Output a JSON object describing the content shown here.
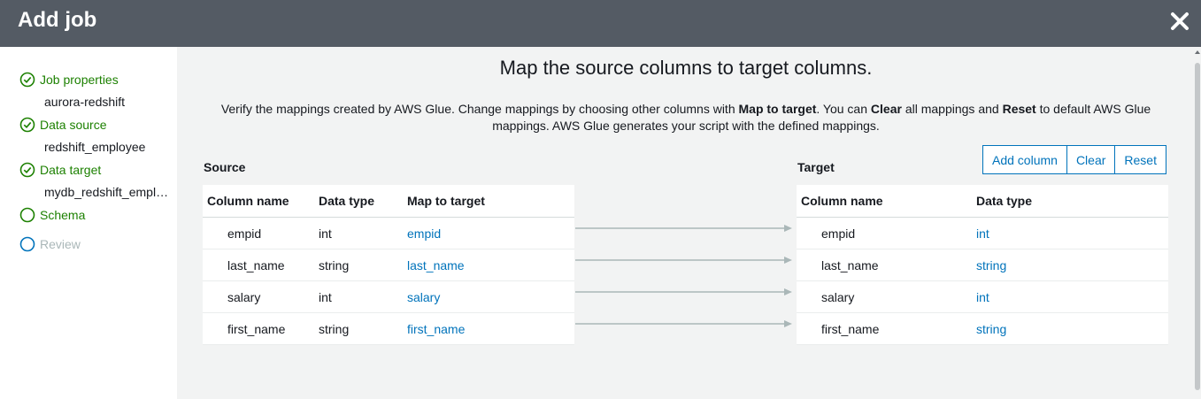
{
  "header": {
    "title": "Add job"
  },
  "steps": [
    {
      "label": "Job properties",
      "status": "complete",
      "value": "aurora-redshift"
    },
    {
      "label": "Data source",
      "status": "complete",
      "value": "redshift_employee"
    },
    {
      "label": "Data target",
      "status": "complete",
      "value": "mydb_redshift_employee"
    },
    {
      "label": "Schema",
      "status": "current"
    },
    {
      "label": "Review",
      "status": "disabled"
    }
  ],
  "main": {
    "heading": "Map the source columns to target columns.",
    "description": {
      "p1": "Verify the mappings created by AWS Glue. Change mappings by choosing other columns with ",
      "b1": "Map to target",
      "p2": ". You can ",
      "b2": "Clear",
      "p3": " all mappings and ",
      "b3": "Reset",
      "p4": " to default AWS Glue mappings. AWS Glue generates your script with the defined mappings."
    },
    "source_label": "Source",
    "target_label": "Target",
    "buttons": {
      "add_column": "Add column",
      "clear": "Clear",
      "reset": "Reset"
    }
  },
  "source_table": {
    "headers": [
      "Column name",
      "Data type",
      "Map to target"
    ],
    "rows": [
      [
        "empid",
        "int",
        "empid"
      ],
      [
        "last_name",
        "string",
        "last_name"
      ],
      [
        "salary",
        "int",
        "salary"
      ],
      [
        "first_name",
        "string",
        "first_name"
      ]
    ]
  },
  "target_table": {
    "headers": [
      "Column name",
      "Data type"
    ],
    "rows": [
      [
        "empid",
        "int"
      ],
      [
        "last_name",
        "string"
      ],
      [
        "salary",
        "int"
      ],
      [
        "first_name",
        "string"
      ]
    ]
  },
  "colors": {
    "header_bg": "#545b64",
    "success": "#1d8102",
    "link": "#0073bb",
    "info": "#0073bb",
    "disabled": "#aab7b8"
  }
}
